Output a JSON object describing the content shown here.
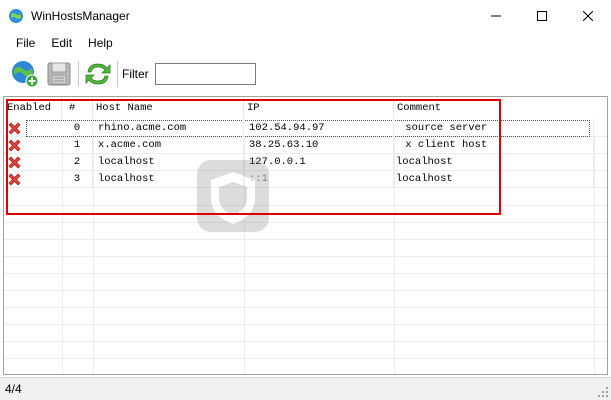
{
  "window": {
    "title": "WinHostsManager",
    "minimize_icon": "minimize-icon",
    "maximize_icon": "maximize-icon",
    "close_icon": "close-icon"
  },
  "menu": [
    "File",
    "Edit",
    "Help"
  ],
  "toolbar": {
    "filter_label": "Filter",
    "filter_value": "",
    "buttons": [
      "add-globe-icon",
      "save-disk-icon",
      "refresh-icon"
    ]
  },
  "grid": {
    "columns": [
      "Enabled",
      "#",
      "Host Name",
      "IP",
      "Comment"
    ],
    "rows": [
      {
        "enabled": false,
        "index": "0",
        "host": "rhino.acme.com",
        "ip": "102.54.94.97",
        "comment": " source server"
      },
      {
        "enabled": false,
        "index": "1",
        "host": "x.acme.com",
        "ip": "38.25.63.10",
        "comment": " x client host"
      },
      {
        "enabled": false,
        "index": "2",
        "host": "localhost",
        "ip": "127.0.0.1",
        "comment": "localhost"
      },
      {
        "enabled": false,
        "index": "3",
        "host": "localhost",
        "ip": "::1",
        "comment": "localhost"
      }
    ]
  },
  "status": {
    "text": "4/4"
  },
  "colors": {
    "highlight": "#e00000",
    "disabled_x": "#e0403a"
  }
}
